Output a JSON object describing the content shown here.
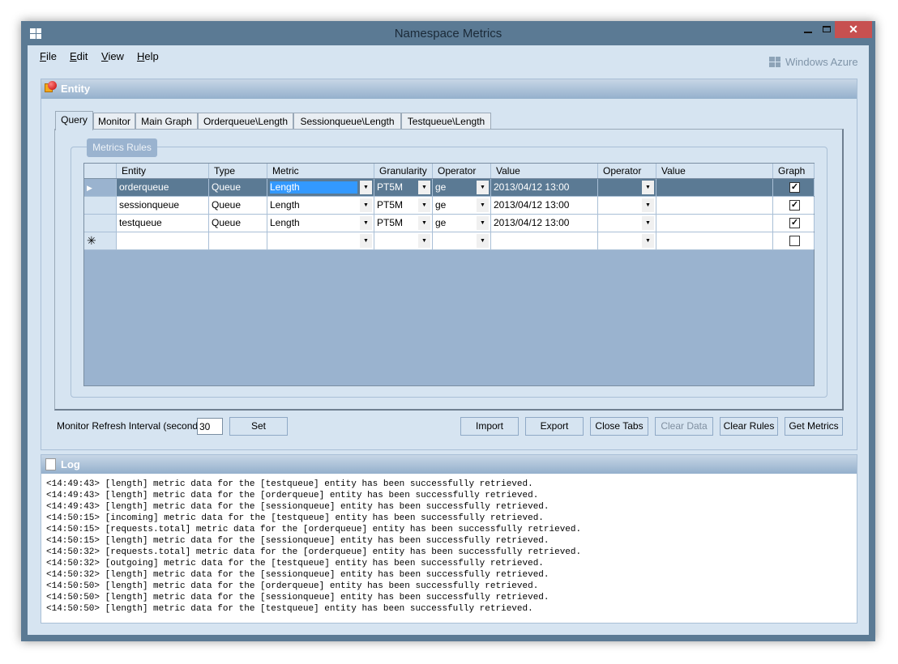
{
  "window": {
    "title": "Namespace Metrics",
    "brand": "Windows Azure"
  },
  "menu": [
    "File",
    "Edit",
    "View",
    "Help"
  ],
  "entity_panel": {
    "title": "Entity"
  },
  "tabs": [
    "Query",
    "Monitor",
    "Main Graph",
    "Orderqueue\\Length",
    "Sessionqueue\\Length",
    "Testqueue\\Length"
  ],
  "group": {
    "title": "Metrics Rules"
  },
  "grid": {
    "columns": [
      "Entity",
      "Type",
      "Metric",
      "Granularity",
      "Operator",
      "Value",
      "Operator",
      "Value",
      "Graph"
    ],
    "rows": [
      {
        "entity": "orderqueue",
        "type": "Queue",
        "metric": "Length",
        "granularity": "PT5M",
        "op1": "ge",
        "value1": "2013/04/12 13:00",
        "op2": "",
        "value2": "",
        "graph": true,
        "selected": true
      },
      {
        "entity": "sessionqueue",
        "type": "Queue",
        "metric": "Length",
        "granularity": "PT5M",
        "op1": "ge",
        "value1": "2013/04/12 13:00",
        "op2": "",
        "value2": "",
        "graph": true
      },
      {
        "entity": "testqueue",
        "type": "Queue",
        "metric": "Length",
        "granularity": "PT5M",
        "op1": "ge",
        "value1": "2013/04/12 13:00",
        "op2": "",
        "value2": "",
        "graph": true
      },
      {
        "entity": "",
        "type": "",
        "metric": "",
        "granularity": "",
        "op1": "",
        "value1": "",
        "op2": "",
        "value2": "",
        "graph": false,
        "new": true
      }
    ]
  },
  "refresh": {
    "label": "Monitor Refresh Interval (seconds):",
    "value": "30",
    "set_label": "Set"
  },
  "buttons": [
    {
      "label": "Import"
    },
    {
      "label": "Export"
    },
    {
      "label": "Close Tabs"
    },
    {
      "label": "Clear Data",
      "disabled": true
    },
    {
      "label": "Clear Rules"
    },
    {
      "label": "Get Metrics"
    }
  ],
  "log_panel": {
    "title": "Log",
    "lines": [
      "<14:49:43> [length] metric data for the [testqueue] entity has been successfully retrieved.",
      "<14:49:43> [length] metric data for the [orderqueue] entity has been successfully retrieved.",
      "<14:49:43> [length] metric data for the [sessionqueue] entity has been successfully retrieved.",
      "<14:50:15> [incoming] metric data for the [testqueue] entity has been successfully retrieved.",
      "<14:50:15> [requests.total] metric data for the [orderqueue] entity has been successfully retrieved.",
      "<14:50:15> [length] metric data for the [sessionqueue] entity has been successfully retrieved.",
      "<14:50:32> [requests.total] metric data for the [orderqueue] entity has been successfully retrieved.",
      "<14:50:32> [outgoing] metric data for the [testqueue] entity has been successfully retrieved.",
      "<14:50:32> [length] metric data for the [sessionqueue] entity has been successfully retrieved.",
      "<14:50:50> [length] metric data for the [orderqueue] entity has been successfully retrieved.",
      "<14:50:50> [length] metric data for the [sessionqueue] entity has been successfully retrieved.",
      "<14:50:50> [length] metric data for the [testqueue] entity has been successfully retrieved."
    ]
  },
  "colors": {
    "titlebar": "#5b7a94",
    "close": "#c75050",
    "client": "#d6e4f1",
    "selection": "#5b7a94",
    "edit_highlight": "#3399ff"
  }
}
